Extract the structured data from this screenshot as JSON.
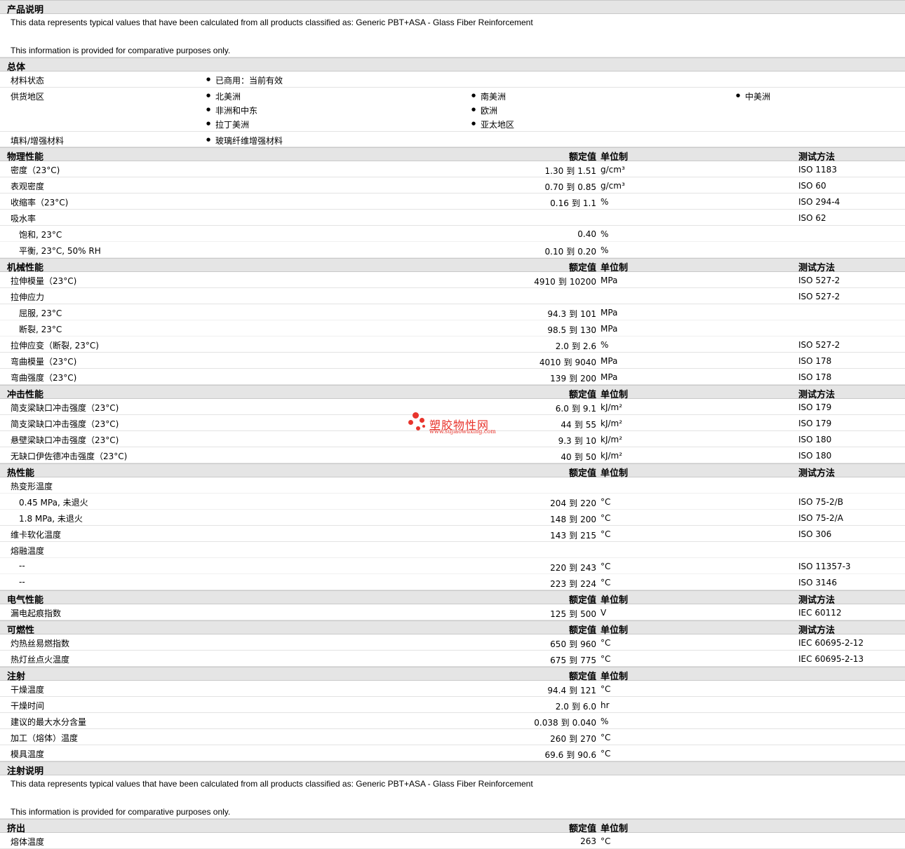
{
  "product": {
    "title": "产品说明",
    "line1": "This data represents typical values that have been calculated from all products classified as: Generic PBT+ASA - Glass Fiber Reinforcement",
    "line2": "This information is provided for comparative purposes only."
  },
  "general": {
    "title": "总体",
    "status_label": "材料状态",
    "status_value": "已商用：当前有效",
    "region_label": "供货地区",
    "regions": [
      "北美洲",
      "南美洲",
      "中美洲",
      "非洲和中东",
      "欧洲",
      "拉丁美洲",
      "亚太地区"
    ],
    "filler_label": "填料/增强材料",
    "filler_value": "玻璃纤维增强材料"
  },
  "cols": {
    "nominal": "额定值",
    "unit": "单位制",
    "method": "测试方法",
    "to": "到"
  },
  "physical": {
    "title": "物理性能",
    "rows": [
      {
        "label": "密度（23°C)",
        "lo": "1.30",
        "hi": "1.51",
        "unit": "g/cm³",
        "method": "ISO 1183"
      },
      {
        "label": "表观密度",
        "lo": "0.70",
        "hi": "0.85",
        "unit": "g/cm³",
        "method": "ISO 60"
      },
      {
        "label": "收缩率（23°C)",
        "lo": "0.16",
        "hi": "1.1",
        "unit": "%",
        "method": "ISO 294-4"
      },
      {
        "label": "吸水率",
        "method": "ISO 62"
      },
      {
        "label": "饱和, 23°C",
        "single": "0.40",
        "unit": "%"
      },
      {
        "label": "平衡, 23°C, 50% RH",
        "lo": "0.10",
        "hi": "0.20",
        "unit": "%"
      }
    ]
  },
  "mechanical": {
    "title": "机械性能",
    "rows": [
      {
        "label": "拉伸模量（23°C)",
        "lo": "4910",
        "hi": "10200",
        "unit": "MPa",
        "method": "ISO 527-2"
      },
      {
        "label": "拉伸应力",
        "method": "ISO 527-2"
      },
      {
        "label": "屈服, 23°C",
        "lo": "94.3",
        "hi": "101",
        "unit": "MPa"
      },
      {
        "label": "断裂, 23°C",
        "lo": "98.5",
        "hi": "130",
        "unit": "MPa"
      },
      {
        "label": "拉伸应变（断裂, 23°C)",
        "lo": "2.0",
        "hi": "2.6",
        "unit": "%",
        "method": "ISO 527-2"
      },
      {
        "label": "弯曲模量（23°C)",
        "lo": "4010",
        "hi": "9040",
        "unit": "MPa",
        "method": "ISO 178"
      },
      {
        "label": "弯曲强度（23°C)",
        "lo": "139",
        "hi": "200",
        "unit": "MPa",
        "method": "ISO 178"
      }
    ]
  },
  "impact": {
    "title": "冲击性能",
    "rows": [
      {
        "label": "简支梁缺口冲击强度（23°C)",
        "lo": "6.0",
        "hi": "9.1",
        "unit": "kJ/m²",
        "method": "ISO 179"
      },
      {
        "label": "简支梁缺口冲击强度（23°C)",
        "lo": "44",
        "hi": "55",
        "unit": "kJ/m²",
        "method": "ISO 179"
      },
      {
        "label": "悬壁梁缺口冲击强度（23°C)",
        "lo": "9.3",
        "hi": "10",
        "unit": "kJ/m²",
        "method": "ISO 180"
      },
      {
        "label": "无缺口伊佐德冲击强度（23°C)",
        "lo": "40",
        "hi": "50",
        "unit": "kJ/m²",
        "method": "ISO 180"
      }
    ]
  },
  "thermal": {
    "title": "热性能",
    "rows": [
      {
        "label": "热变形温度"
      },
      {
        "label": "0.45 MPa, 未退火",
        "lo": "204",
        "hi": "220",
        "unit": "°C",
        "method": "ISO 75-2/B"
      },
      {
        "label": "1.8 MPa, 未退火",
        "lo": "148",
        "hi": "200",
        "unit": "°C",
        "method": "ISO 75-2/A"
      },
      {
        "label": "维卡软化温度",
        "lo": "143",
        "hi": "215",
        "unit": "°C",
        "method": "ISO 306"
      },
      {
        "label": "熔融温度"
      },
      {
        "label": "--",
        "lo": "220",
        "hi": "243",
        "unit": "°C",
        "method": "ISO 11357-3"
      },
      {
        "label": "--",
        "lo": "223",
        "hi": "224",
        "unit": "°C",
        "method": "ISO 3146"
      }
    ]
  },
  "electrical": {
    "title": "电气性能",
    "rows": [
      {
        "label": "漏电起痕指数",
        "lo": "125",
        "hi": "500",
        "unit": "V",
        "method": "IEC 60112"
      }
    ]
  },
  "flammability": {
    "title": "可燃性",
    "rows": [
      {
        "label": "灼热丝易燃指数",
        "lo": "650",
        "hi": "960",
        "unit": "°C",
        "method": "IEC 60695-2-12"
      },
      {
        "label": "热灯丝点火温度",
        "lo": "675",
        "hi": "775",
        "unit": "°C",
        "method": "IEC 60695-2-13"
      }
    ]
  },
  "injection": {
    "title": "注射",
    "rows": [
      {
        "label": "干燥温度",
        "lo": "94.4",
        "hi": "121",
        "unit": "°C"
      },
      {
        "label": "干燥时间",
        "lo": "2.0",
        "hi": "6.0",
        "unit": "hr"
      },
      {
        "label": "建议的最大水分含量",
        "lo": "0.038",
        "hi": "0.040",
        "unit": "%"
      },
      {
        "label": "加工（熔体）温度",
        "lo": "260",
        "hi": "270",
        "unit": "°C"
      },
      {
        "label": "模具温度",
        "lo": "69.6",
        "hi": "90.6",
        "unit": "°C"
      }
    ]
  },
  "injection_note": {
    "title": "注射说明",
    "line1": "This data represents typical values that have been calculated from all products classified as: Generic PBT+ASA - Glass Fiber Reinforcement",
    "line2": "This information is provided for comparative purposes only."
  },
  "extrusion": {
    "title": "挤出",
    "rows": [
      {
        "label": "熔体温度",
        "single": "263",
        "unit": "°C"
      }
    ]
  },
  "watermark": {
    "name": "塑胶物性网",
    "url": "www.sujiaowuxing.com",
    "color": "#e8342c"
  }
}
